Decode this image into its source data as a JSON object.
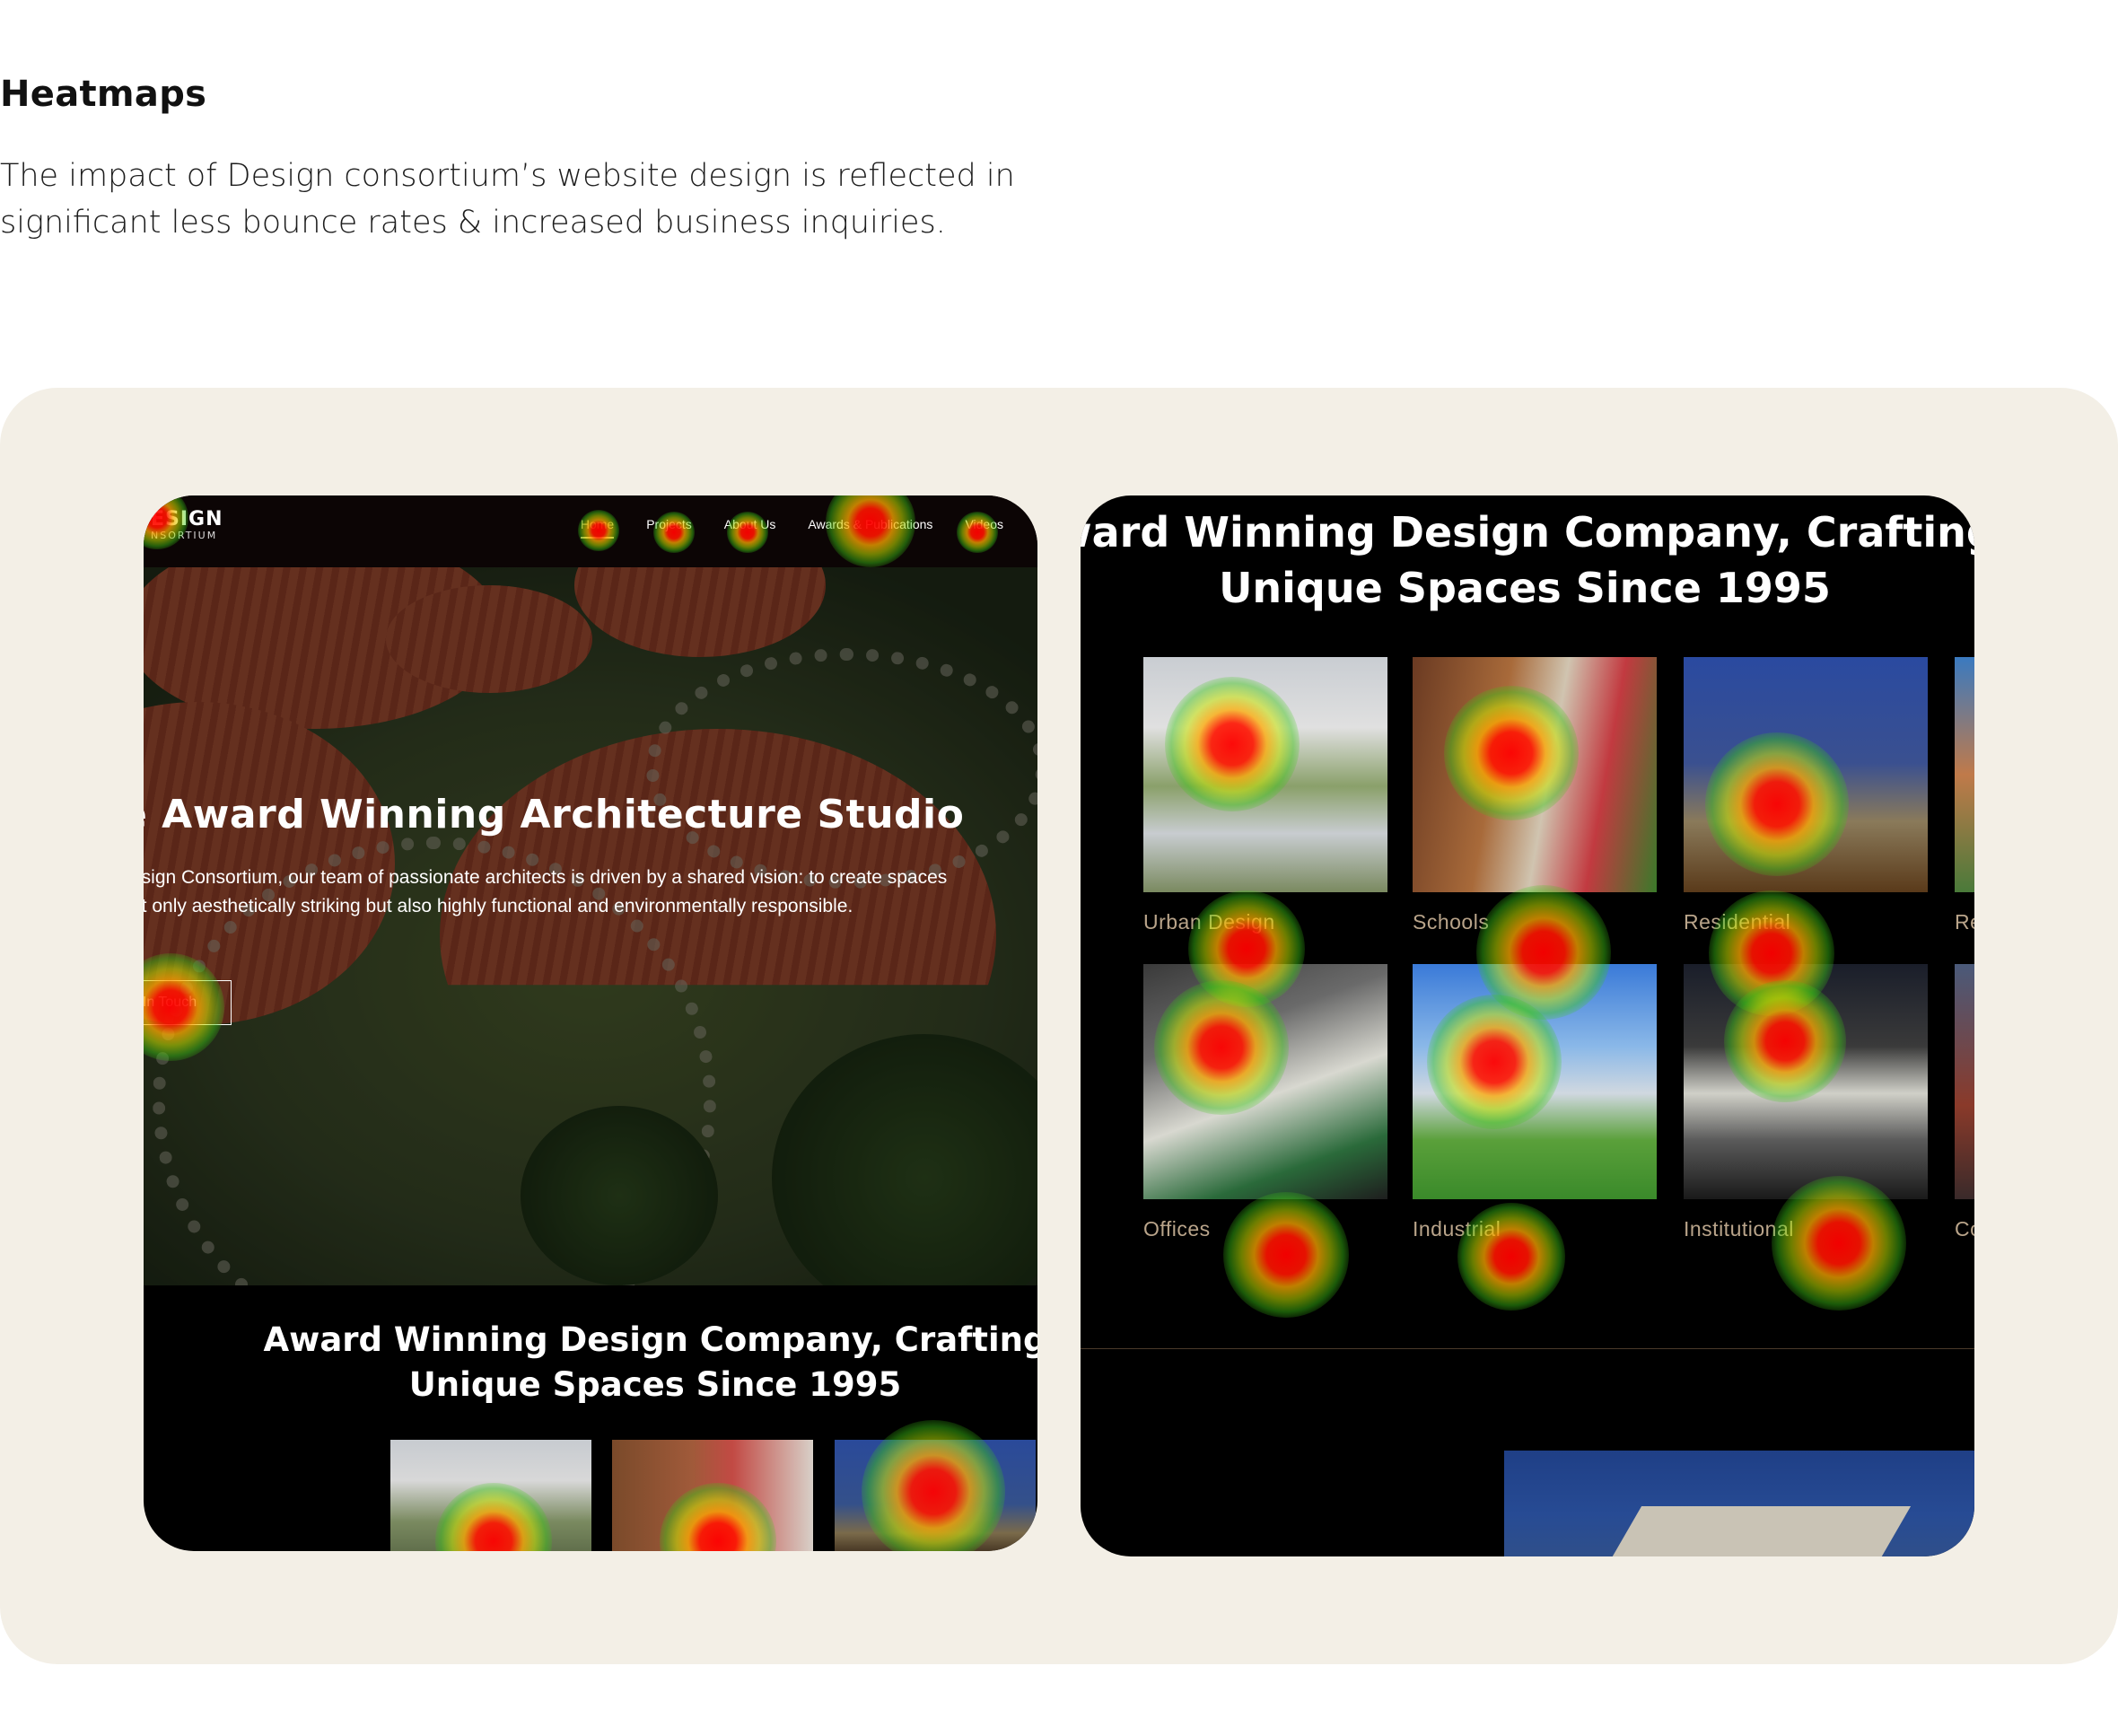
{
  "page": {
    "heading": "Heatmaps",
    "description": "The impact of Design consortium’s website design is reflected in significant less bounce rates & increased business inquiries."
  },
  "left_screen": {
    "logo_line1": "ESIGN",
    "logo_line2": "NSORTIUM",
    "nav": [
      "Home",
      "Projects",
      "About Us",
      "Awards & Publications",
      "Videos"
    ],
    "hero_title": "e Award Winning Architecture Studio",
    "hero_text": "esign Consortium, our team of passionate architects is driven by a shared vision: to create spaces\not only aesthetically striking but also highly functional and environmentally responsible.",
    "cta_label": "In Touch",
    "section_title": "Award Winning Design Company, Crafting Unique Spaces Since 1995"
  },
  "right_screen": {
    "title": "ward Winning Design Company, Crafting\nUnique Spaces Since 1995",
    "categories_row1": [
      "Urban Design",
      "Schools",
      "Residential",
      "Re"
    ],
    "categories_row2": [
      "Offices",
      "Industrial",
      "Institutional",
      "Co"
    ]
  },
  "colors": {
    "panel_bg": "#f3efe6",
    "nav_active": "#e3b57a",
    "label_tan": "#b9a48a",
    "heat_hot": "#ff0000",
    "heat_warm": "#ffaa00",
    "heat_cool": "#33cc22"
  }
}
